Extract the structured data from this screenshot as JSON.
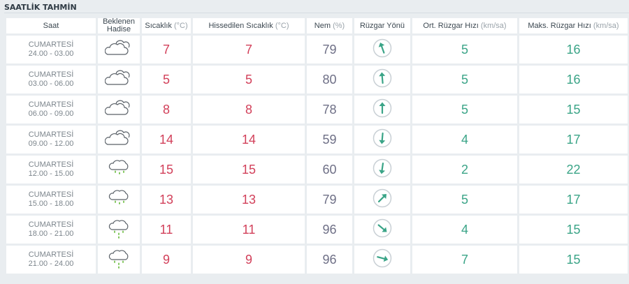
{
  "page": {
    "title": "SAATLİK TAHMİN"
  },
  "headers": {
    "saat": "Saat",
    "hadise_line1": "Beklenen",
    "hadise_line2": "Hadise",
    "sicaklik": "Sıcaklık",
    "sicaklik_unit": "(°C)",
    "hissedilen": "Hissedilen Sıcaklık",
    "hissedilen_unit": "(°C)",
    "nem": "Nem",
    "nem_unit": "(%)",
    "ruzgar_yonu": "Rüzgar Yönü",
    "ort_ruzgar": "Ort. Rüzgar Hızı",
    "ort_ruzgar_unit": "(km/sa)",
    "maks_ruzgar": "Maks. Rüzgar Hızı",
    "maks_ruzgar_unit": "(km/sa)"
  },
  "colors": {
    "temperature": "#d2405a",
    "humidity": "#6e6f86",
    "wind_speed": "#3aa487",
    "wind_arrow": "#3aa487",
    "rain_drop": "#6fbe45",
    "cloud_stroke": "#5a6168"
  },
  "rows": [
    {
      "day": "CUMARTESİ",
      "time": "24.00 - 03.00",
      "icon": "cloudy-icon",
      "temp": "7",
      "feels": "7",
      "humidity": "79",
      "wind_dir_deg": 340,
      "wind_avg": "5",
      "wind_max": "16"
    },
    {
      "day": "CUMARTESİ",
      "time": "03.00 - 06.00",
      "icon": "cloudy-icon",
      "temp": "5",
      "feels": "5",
      "humidity": "80",
      "wind_dir_deg": 355,
      "wind_avg": "5",
      "wind_max": "16"
    },
    {
      "day": "CUMARTESİ",
      "time": "06.00 - 09.00",
      "icon": "cloudy-icon",
      "temp": "8",
      "feels": "8",
      "humidity": "78",
      "wind_dir_deg": 0,
      "wind_avg": "5",
      "wind_max": "15"
    },
    {
      "day": "CUMARTESİ",
      "time": "09.00 - 12.00",
      "icon": "cloudy-icon",
      "temp": "14",
      "feels": "14",
      "humidity": "59",
      "wind_dir_deg": 185,
      "wind_avg": "4",
      "wind_max": "17"
    },
    {
      "day": "CUMARTESİ",
      "time": "12.00 - 15.00",
      "icon": "light-rain-icon",
      "temp": "15",
      "feels": "15",
      "humidity": "60",
      "wind_dir_deg": 188,
      "wind_avg": "2",
      "wind_max": "22"
    },
    {
      "day": "CUMARTESİ",
      "time": "15.00 - 18.00",
      "icon": "light-rain-icon",
      "temp": "13",
      "feels": "13",
      "humidity": "79",
      "wind_dir_deg": 45,
      "wind_avg": "5",
      "wind_max": "17"
    },
    {
      "day": "CUMARTESİ",
      "time": "18.00 - 21.00",
      "icon": "rain-icon",
      "temp": "11",
      "feels": "11",
      "humidity": "96",
      "wind_dir_deg": 130,
      "wind_avg": "4",
      "wind_max": "15"
    },
    {
      "day": "CUMARTESİ",
      "time": "21.00 - 24.00",
      "icon": "rain-icon",
      "temp": "9",
      "feels": "9",
      "humidity": "96",
      "wind_dir_deg": 105,
      "wind_avg": "7",
      "wind_max": "15"
    }
  ]
}
